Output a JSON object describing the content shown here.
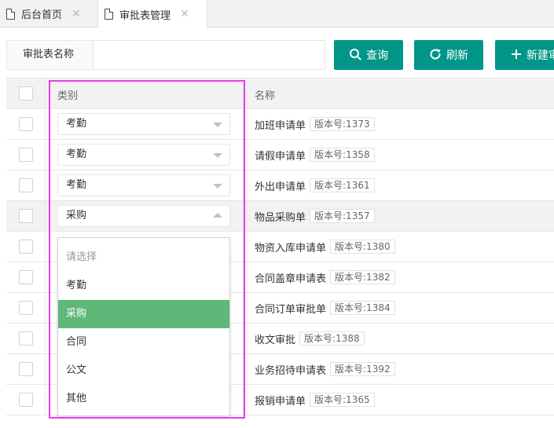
{
  "tabs": [
    {
      "label": "后台首页",
      "active": false
    },
    {
      "label": "审批表管理",
      "active": true
    }
  ],
  "search": {
    "label": "审批表名称",
    "value": "",
    "placeholder": ""
  },
  "buttons": {
    "query": "查询",
    "refresh": "刷新",
    "new": "新建审"
  },
  "table": {
    "headers": {
      "type": "类别",
      "name": "名称"
    },
    "rows": [
      {
        "type": "考勤",
        "name": "加班申请单",
        "version": "版本号:1373"
      },
      {
        "type": "考勤",
        "name": "请假申请单",
        "version": "版本号:1358"
      },
      {
        "type": "考勤",
        "name": "外出申请单",
        "version": "版本号:1361"
      },
      {
        "type": "采购",
        "name": "物品采购单",
        "version": "版本号:1357"
      },
      {
        "type": "",
        "name": "物资入库申请单",
        "version": "版本号:1380"
      },
      {
        "type": "",
        "name": "合同盖章申请表",
        "version": "版本号:1382"
      },
      {
        "type": "",
        "name": "合同订单审批单",
        "version": "版本号:1384"
      },
      {
        "type": "",
        "name": "收文审批",
        "version": "版本号:1388"
      },
      {
        "type": "",
        "name": "业务招待申请表",
        "version": "版本号:1392"
      },
      {
        "type": "",
        "name": "报销申请单",
        "version": "版本号:1365"
      }
    ]
  },
  "dropdown": {
    "options": [
      "请选择",
      "考勤",
      "采购",
      "合同",
      "公文",
      "其他"
    ],
    "selected": "采购"
  },
  "colors": {
    "primary": "#009688",
    "selected_option": "#5fb878",
    "highlight_border": "#e83ee8"
  }
}
